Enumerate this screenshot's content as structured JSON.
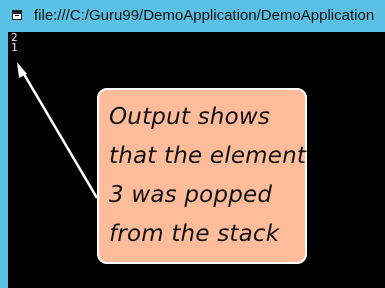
{
  "window": {
    "title": "file:///C:/Guru99/DemoApplication/DemoApplication"
  },
  "console": {
    "lines": [
      "2",
      "1"
    ]
  },
  "callout": {
    "lines": [
      "Output shows",
      "that the element",
      "3 was popped",
      "from the stack"
    ]
  },
  "colors": {
    "titlebar": "#5bc1e4",
    "console_bg": "#000000",
    "console_text": "#e6e6e6",
    "callout_bg": "#ffbc9a",
    "arrow": "#ffffff"
  }
}
